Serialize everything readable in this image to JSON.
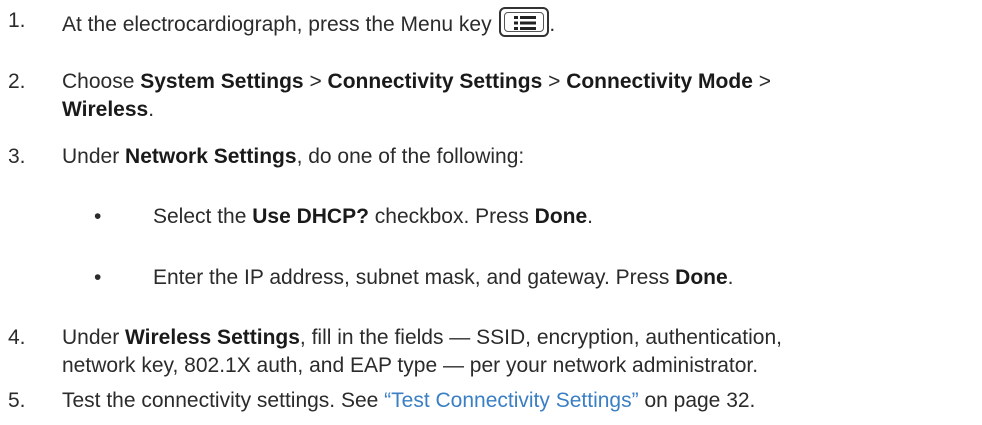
{
  "steps": [
    {
      "number": "1.",
      "text_before_key": "At the electrocardiograph, press the Menu key",
      "key_icon": "menu-key-icon",
      "text_after_key": "."
    },
    {
      "number": "2.",
      "p1": "Choose ",
      "b1": "System Settings",
      "p2": " > ",
      "b2": "Connectivity Settings",
      "p3": " > ",
      "b3": "Connectivity Mode",
      "p4": " >",
      "b4": "Wireless",
      "p5": "."
    },
    {
      "number": "3.",
      "p1": "Under ",
      "b1": "Network Settings",
      "p2": ", do one of the following:"
    },
    {
      "number": "4.",
      "p1": "Under ",
      "b1": "Wireless Settings",
      "p2": ", fill in the fields — SSID, encryption, authentication,",
      "line2": "network key, 802.1X auth, and EAP type — per your network administrator."
    },
    {
      "number": "5.",
      "p1": "Test the connectivity settings. See ",
      "link": "“Test Connectivity Settings”",
      "p2": " on page 32."
    }
  ],
  "bullets": [
    {
      "marker": "•",
      "p1": "Select the ",
      "b1": "Use DHCP?",
      "p2": " checkbox. Press ",
      "b2": "Done",
      "p3": "."
    },
    {
      "marker": "•",
      "p1": "Enter the IP address, subnet mask, and gateway. Press ",
      "b1": "Done",
      "p2": "."
    }
  ],
  "colors": {
    "text": "#2b2b2b",
    "link": "#3a7fc4"
  }
}
